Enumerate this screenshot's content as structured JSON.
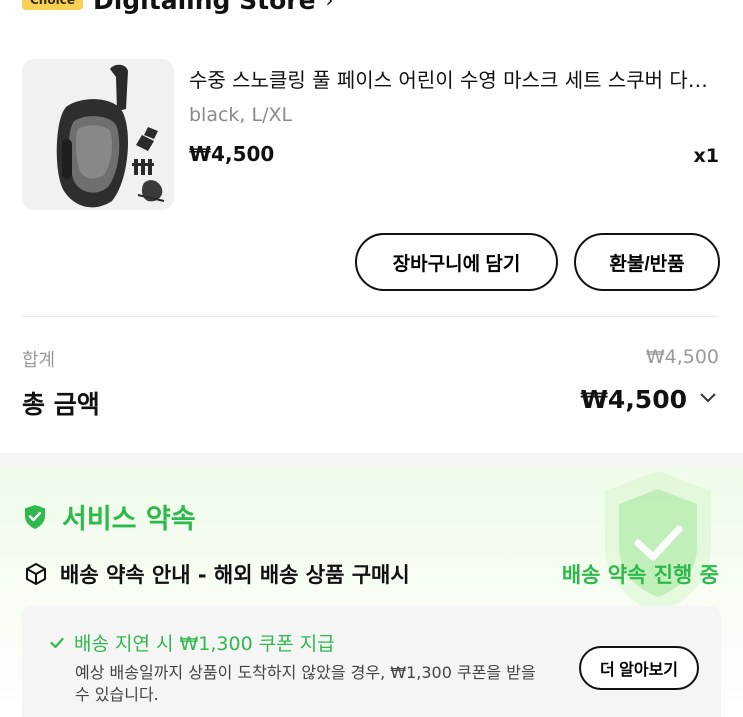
{
  "store": {
    "badge": "Choice",
    "name": "Digitaling Store",
    "chevron": "›"
  },
  "product": {
    "image_icon": "snorkel-mask-image",
    "title": "수중 스노클링 풀 페이스 어린이 수영 마스크 세트 스쿠버 다이빙 호흡 마스크",
    "variant": "black, L/XL",
    "price": "₩4,500",
    "quantity": "x1"
  },
  "actions": {
    "add_to_cart": "장바구니에 담기",
    "refund_return": "환불/반품"
  },
  "summary": {
    "subtotal_label": "합계",
    "subtotal_value": "₩4,500",
    "total_label": "총 금액",
    "total_value": "₩4,500",
    "expand_icon": "chevron-down-icon"
  },
  "service": {
    "title": "서비스 약속",
    "shield_icon": "shield-check-icon",
    "delivery_icon": "box-icon",
    "delivery_text": "배송 약속 안내 - 해외 배송 상품 구매시",
    "delivery_status": "배송 약속 진행 중",
    "promise": {
      "headline": "배송 지연 시 ₩1,300 쿠폰 지급",
      "description": "예상 배송일까지 상품이 도착하지 않았을 경우, ₩1,300 쿠폰을 받을 수 있습니다.",
      "learn_more": "더 알아보기"
    }
  },
  "colors": {
    "accent_green": "#2fb94d",
    "choice_badge": "#f7d154",
    "panel_bg": "#effbe9"
  }
}
